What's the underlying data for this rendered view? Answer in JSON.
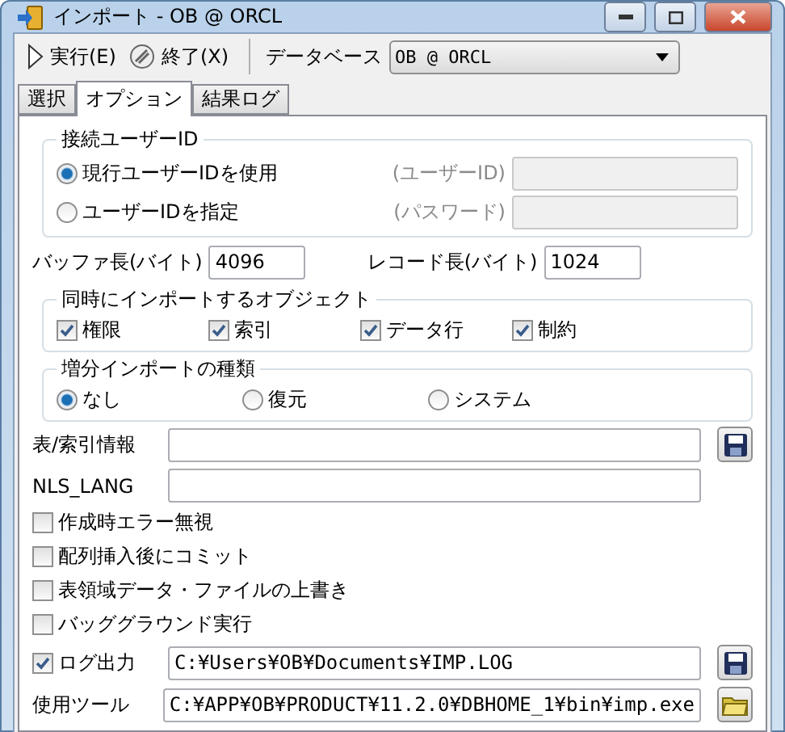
{
  "window": {
    "title": "インポート - OB @ ORCL"
  },
  "toolbar": {
    "run": "実行(E)",
    "stop": "終了(X)",
    "database_label": "データベース",
    "database_value": "OB @ ORCL"
  },
  "tabs": [
    {
      "label": "選択",
      "selected": false
    },
    {
      "label": "オプション",
      "selected": true
    },
    {
      "label": "結果ログ",
      "selected": false
    }
  ],
  "connect_user": {
    "title": "接続ユーザーID",
    "options": [
      {
        "label": "現行ユーザーIDを使用",
        "selected": true
      },
      {
        "label": "ユーザーIDを指定",
        "selected": false
      }
    ],
    "fields": [
      {
        "label": "(ユーザーID)",
        "disabled": true
      },
      {
        "label": "(パスワード)",
        "disabled": true
      }
    ]
  },
  "buffer": {
    "label": "バッファ長(バイト)",
    "value": "4096"
  },
  "record": {
    "label": "レコード長(バイト)",
    "value": "1024"
  },
  "objects": {
    "title": "同時にインポートするオブジェクト",
    "items": [
      {
        "label": "権限",
        "checked": true
      },
      {
        "label": "索引",
        "checked": true
      },
      {
        "label": "データ行",
        "checked": true
      },
      {
        "label": "制約",
        "checked": true
      }
    ]
  },
  "incremental": {
    "title": "増分インポートの種類",
    "options": [
      {
        "label": "なし",
        "selected": true
      },
      {
        "label": "復元",
        "selected": false
      },
      {
        "label": "システム",
        "selected": false
      }
    ]
  },
  "table_info": {
    "label": "表/索引情報"
  },
  "nls_lang": {
    "label": "NLS_LANG"
  },
  "options": [
    {
      "label": "作成時エラー無視",
      "checked": false
    },
    {
      "label": "配列挿入後にコミット",
      "checked": false
    },
    {
      "label": "表領域データ・ファイルの上書き",
      "checked": false
    },
    {
      "label": "バッググラウンド実行",
      "checked": false
    }
  ],
  "log_output": {
    "label": "ログ出力",
    "checked": true,
    "value": "C:¥Users¥OB¥Documents¥IMP.LOG"
  },
  "tool": {
    "label": "使用ツール",
    "value": "C:¥APP¥OB¥PRODUCT¥11.2.0¥DBHOME_1¥bin¥imp.exe"
  }
}
